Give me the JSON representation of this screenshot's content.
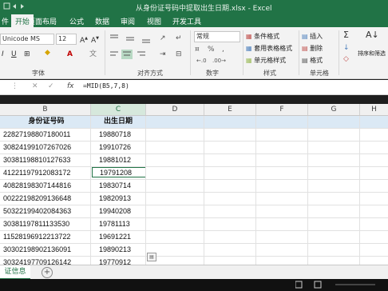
{
  "window": {
    "title": "从身份证号码中提取出生日期.xlsx - Excel"
  },
  "menu": [
    {
      "label": "件"
    },
    {
      "label": "开始"
    },
    {
      "label": "插入"
    },
    {
      "label": "页面布局"
    },
    {
      "label": "公式"
    },
    {
      "label": "数据"
    },
    {
      "label": "审阅"
    },
    {
      "label": "视图"
    },
    {
      "label": "开发工具"
    }
  ],
  "ribbon": {
    "font_name": "Unicode MS",
    "font_size": "12",
    "number_format": "常规",
    "conditional_format": "条件格式",
    "table_format": "套用表格格式",
    "cell_style": "单元格样式",
    "insert": "插入",
    "delete": "删除",
    "format": "格式",
    "sort_filter": "排序和筛选",
    "groups": {
      "font": "字体",
      "alignment": "对齐方式",
      "number": "数字",
      "styles": "样式",
      "cells": "单元格"
    }
  },
  "formula_bar": {
    "formula": "=MID(B5,7,8)"
  },
  "columns": [
    "B",
    "C",
    "D",
    "E",
    "F",
    "G",
    "H"
  ],
  "table": {
    "header": [
      "身份证号码",
      "出生日期"
    ],
    "rows": [
      [
        "22827198807180011",
        "19880718"
      ],
      [
        "30824199107267026",
        "19910726"
      ],
      [
        "30381198810127633",
        "19881012"
      ],
      [
        "41221197912083172",
        "19791208"
      ],
      [
        "40828198307144816",
        "19830714"
      ],
      [
        "00222198209136648",
        "19820913"
      ],
      [
        "50322199402084363",
        "19940208"
      ],
      [
        "30381197811133530",
        "19781113"
      ],
      [
        "11528196912213722",
        "19691221"
      ],
      [
        "30302198902136091",
        "19890213"
      ],
      [
        "30324197709126142",
        "19770912"
      ]
    ]
  },
  "sheet": {
    "active_tab": "证信息"
  }
}
